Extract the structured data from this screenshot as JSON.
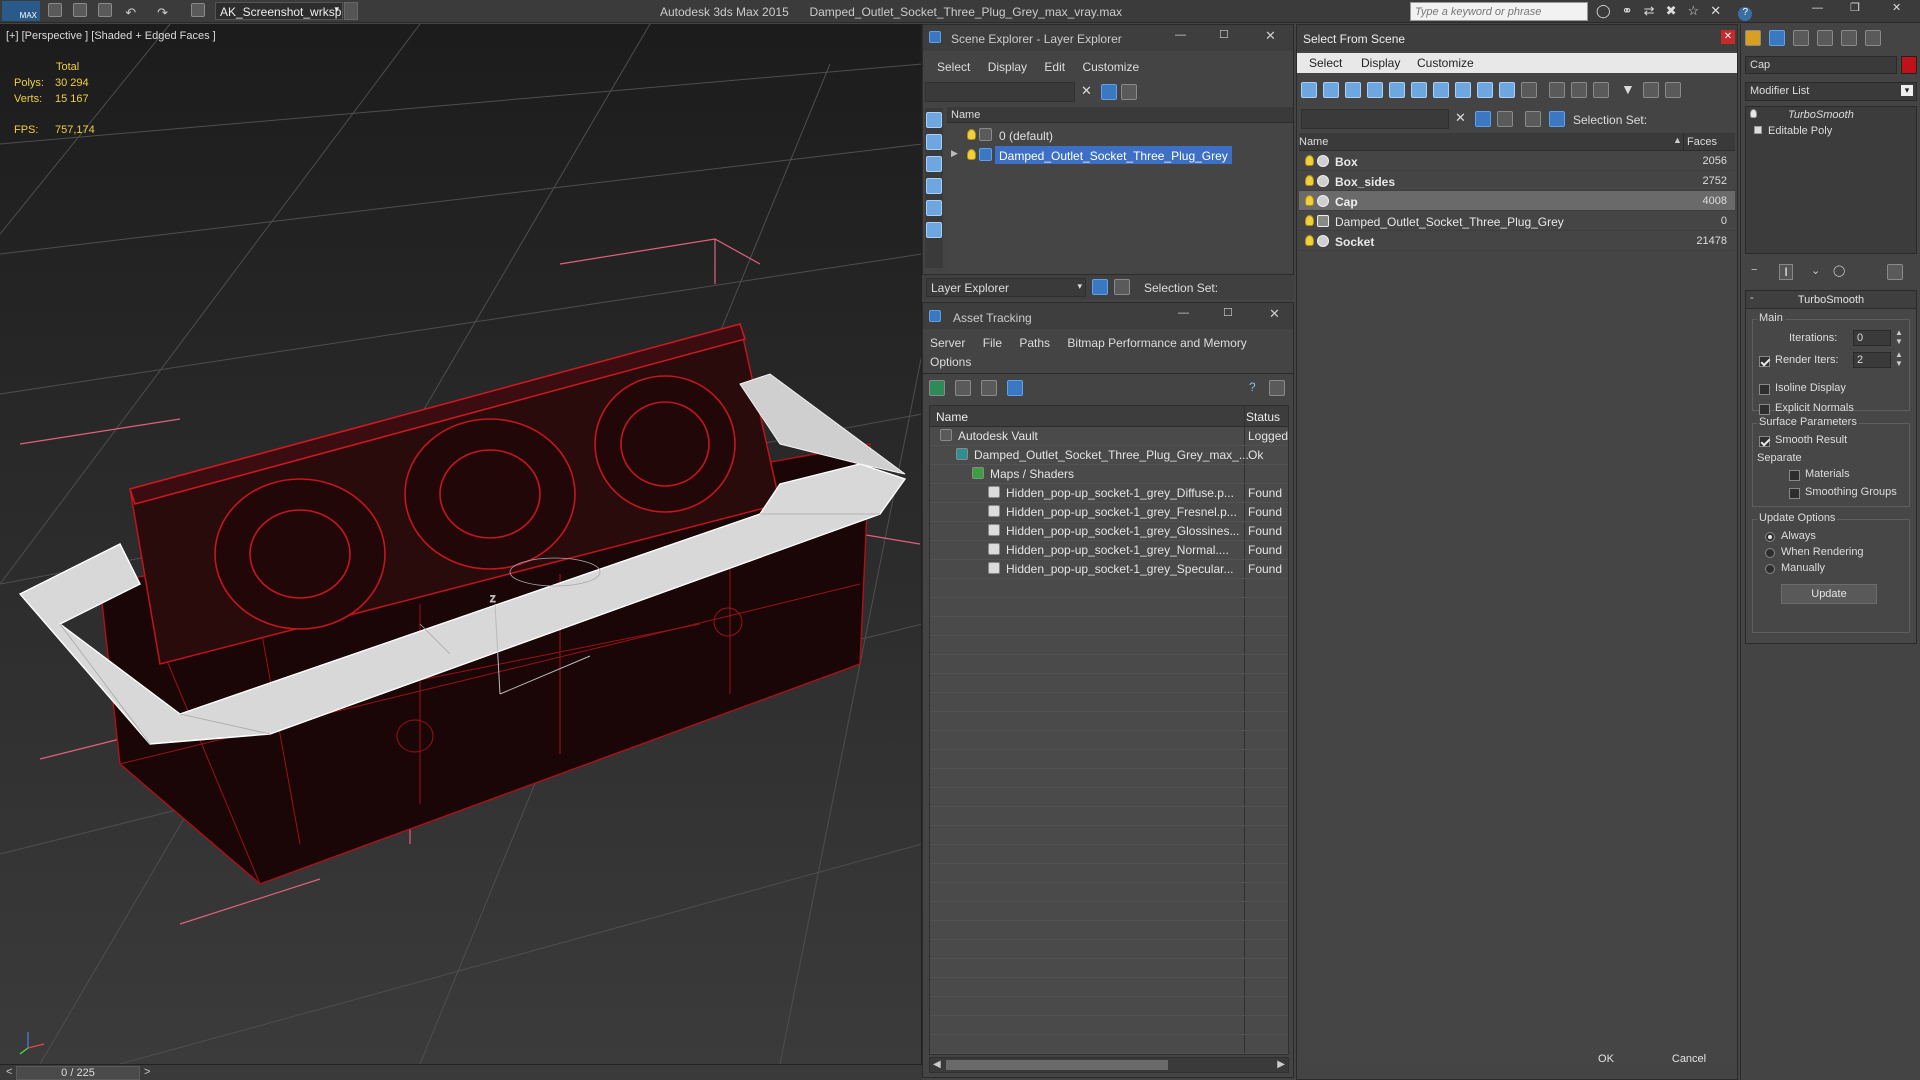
{
  "titlebar": {
    "logo": "MAX",
    "workspace": "AK_Screenshot_wrksp",
    "app": "Autodesk 3ds Max  2015",
    "file": "Damped_Outlet_Socket_Three_Plug_Grey_max_vray.max",
    "search_placeholder": "Type a keyword or phrase"
  },
  "viewport": {
    "label": "[+] [Perspective ] [Shaded + Edged Faces ]",
    "stats": {
      "total_label": "Total",
      "polys_label": "Polys:",
      "polys": "30 294",
      "verts_label": "Verts:",
      "verts": "15 167",
      "fps_label": "FPS:",
      "fps": "757,174"
    },
    "timeline": "0 / 225"
  },
  "scene_explorer": {
    "title": "Scene Explorer - Layer Explorer",
    "menu": [
      "Select",
      "Display",
      "Edit",
      "Customize"
    ],
    "col_name": "Name",
    "rows": [
      {
        "label": "0 (default)",
        "selected": false
      },
      {
        "label": "Damped_Outlet_Socket_Three_Plug_Grey",
        "selected": true
      }
    ],
    "footer_dropdown": "Layer Explorer",
    "selection_set_label": "Selection Set:"
  },
  "asset_tracking": {
    "title": "Asset Tracking",
    "menu": [
      "Server",
      "File",
      "Paths",
      "Bitmap Performance and Memory"
    ],
    "menu2": "Options",
    "col_name": "Name",
    "col_status": "Status",
    "rows": [
      {
        "name": "Autodesk Vault",
        "status": "Logged",
        "indent": 0
      },
      {
        "name": "Damped_Outlet_Socket_Three_Plug_Grey_max_...",
        "status": "Ok",
        "indent": 1
      },
      {
        "name": "Maps / Shaders",
        "status": "",
        "indent": 2
      },
      {
        "name": "Hidden_pop-up_socket-1_grey_Diffuse.p...",
        "status": "Found",
        "indent": 3
      },
      {
        "name": "Hidden_pop-up_socket-1_grey_Fresnel.p...",
        "status": "Found",
        "indent": 3
      },
      {
        "name": "Hidden_pop-up_socket-1_grey_Glossines...",
        "status": "Found",
        "indent": 3
      },
      {
        "name": "Hidden_pop-up_socket-1_grey_Normal....",
        "status": "Found",
        "indent": 3
      },
      {
        "name": "Hidden_pop-up_socket-1_grey_Specular...",
        "status": "Found",
        "indent": 3
      }
    ]
  },
  "select_from_scene": {
    "title": "Select From Scene",
    "menu": [
      "Select",
      "Display",
      "Customize"
    ],
    "selection_set_label": "Selection Set:",
    "col_name": "Name",
    "col_faces": "Faces",
    "rows": [
      {
        "name": "Box",
        "faces": "2056",
        "bold": true,
        "selected": false
      },
      {
        "name": "Box_sides",
        "faces": "2752",
        "bold": true,
        "selected": false
      },
      {
        "name": "Cap",
        "faces": "4008",
        "bold": true,
        "selected": true
      },
      {
        "name": "Damped_Outlet_Socket_Three_Plug_Grey",
        "faces": "0",
        "bold": false,
        "selected": false
      },
      {
        "name": "Socket",
        "faces": "21478",
        "bold": true,
        "selected": false
      }
    ],
    "ok": "OK",
    "cancel": "Cancel"
  },
  "command_panel": {
    "object_name": "Cap",
    "modifier_list": "Modifier List",
    "stack": [
      "TurboSmooth",
      "Editable Poly"
    ],
    "rollout_title": "TurboSmooth",
    "main_label": "Main",
    "iterations_label": "Iterations:",
    "iterations": "0",
    "render_iters_label": "Render Iters:",
    "render_iters": "2",
    "isoline": "Isoline Display",
    "explicit": "Explicit Normals",
    "surface_params": "Surface Parameters",
    "smooth_result": "Smooth Result",
    "separate": "Separate",
    "materials": "Materials",
    "smoothing_groups": "Smoothing Groups",
    "update_options": "Update Options",
    "always": "Always",
    "when_rendering": "When Rendering",
    "manually": "Manually",
    "update_btn": "Update"
  },
  "colors": {
    "selection_blue": "#3d6fc4",
    "wire_red": "#c0141c",
    "panel": "#444444"
  }
}
